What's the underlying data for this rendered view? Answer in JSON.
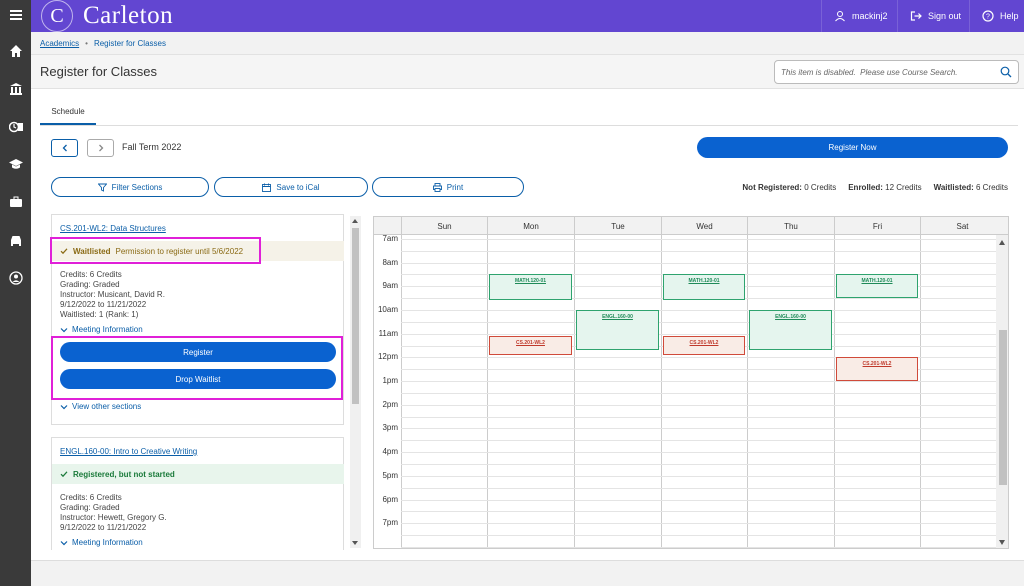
{
  "sidebar": {
    "icons": [
      "menu-icon",
      "home-icon",
      "bank-icon",
      "schedule-icon",
      "graduation-cap-icon",
      "briefcase-icon",
      "car-icon",
      "user-circle-icon"
    ]
  },
  "topbar": {
    "logo_letter": "C",
    "logo_text": "Carleton",
    "user": "mackinj2",
    "sign_out": "Sign out",
    "help": "Help",
    "color": "#6246d1"
  },
  "breadcrumb": {
    "root": "Academics",
    "current": "Register for Classes"
  },
  "page": {
    "title": "Register for Classes",
    "search_placeholder": "This item is disabled.  Please use Course Search."
  },
  "tabs": {
    "schedule": "Schedule"
  },
  "toolbar": {
    "term": "Fall Term 2022",
    "register_now": "Register Now",
    "filter": "Filter Sections",
    "ical": "Save to iCal",
    "print": "Print"
  },
  "credits": {
    "not_registered_label": "Not Registered:",
    "not_registered_value": "0 Credits",
    "enrolled_label": "Enrolled:",
    "enrolled_value": "12 Credits",
    "waitlisted_label": "Waitlisted:",
    "waitlisted_value": "6 Credits"
  },
  "sections": [
    {
      "title": "CS.201-WL2: Data Structures",
      "status": "Waitlisted",
      "status_note": "Permission to register until 5/6/2022",
      "credits": "Credits: 6 Credits",
      "grading": "Grading: Graded",
      "instructor": "Instructor: Musicant, David R.",
      "dates": "9/12/2022 to 11/21/2022",
      "waitlisted": "Waitlisted:  1 (Rank: 1)",
      "meeting_info": "Meeting Information",
      "register": "Register",
      "drop_waitlist": "Drop Waitlist",
      "view_other": "View other sections"
    },
    {
      "title": "ENGL.160-00: Intro to Creative Writing",
      "status": "Registered, but not started",
      "credits": "Credits: 6 Credits",
      "grading": "Grading: Graded",
      "instructor": "Instructor: Hewett, Gregory G.",
      "dates": "9/12/2022 to 11/21/2022",
      "meeting_info": "Meeting Information"
    }
  ],
  "calendar": {
    "days": [
      "Sun",
      "Mon",
      "Tue",
      "Wed",
      "Thu",
      "Fri",
      "Sat"
    ],
    "times": [
      "7am",
      "8am",
      "9am",
      "10am",
      "11am",
      "12pm",
      "1pm",
      "2pm",
      "3pm",
      "4pm",
      "5pm",
      "6pm",
      "7pm"
    ],
    "events": [
      {
        "label": "MATH.120-01",
        "day": 1,
        "start": 8.5,
        "end": 9.6,
        "kind": "math"
      },
      {
        "label": "MATH.120-01",
        "day": 3,
        "start": 8.5,
        "end": 9.6,
        "kind": "math"
      },
      {
        "label": "MATH.120-01",
        "day": 5,
        "start": 8.5,
        "end": 9.5,
        "kind": "math"
      },
      {
        "label": "ENGL.160-00",
        "day": 2,
        "start": 10.0,
        "end": 11.7,
        "kind": "engl"
      },
      {
        "label": "ENGL.160-00",
        "day": 4,
        "start": 10.0,
        "end": 11.7,
        "kind": "engl"
      },
      {
        "label": "CS.201-WL2",
        "day": 1,
        "start": 11.1,
        "end": 11.9,
        "kind": "cs"
      },
      {
        "label": "CS.201-WL2",
        "day": 3,
        "start": 11.1,
        "end": 11.9,
        "kind": "cs"
      },
      {
        "label": "CS.201-WL2",
        "day": 5,
        "start": 12.0,
        "end": 13.0,
        "kind": "cs"
      }
    ]
  },
  "colors": {
    "accent": "#0a62d0",
    "highlight": "#e020d8",
    "waitlist": "#8a6a14",
    "registered": "#1a7a3a"
  }
}
